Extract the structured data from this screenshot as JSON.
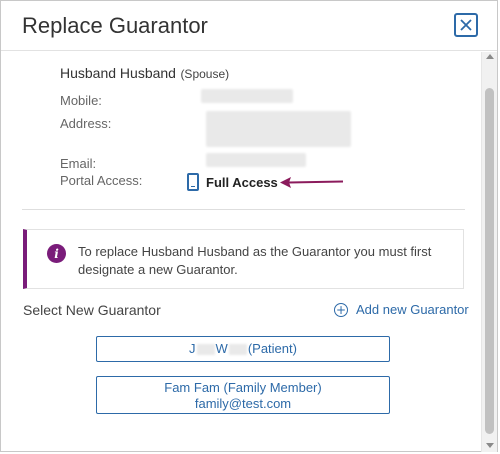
{
  "dialog": {
    "title": "Replace Guarantor"
  },
  "guarantor": {
    "name": "Husband Husband",
    "relationship": "(Spouse)",
    "labels": {
      "mobile": "Mobile:",
      "address": "Address:",
      "email": "Email:",
      "portal_access": "Portal Access:"
    },
    "portal_access_value": "Full Access"
  },
  "alert": {
    "message": "To replace Husband Husband as the Guarantor you must first designate a new Guarantor."
  },
  "select_section": {
    "label": "Select New Guarantor",
    "add_new_label": "Add new Guarantor"
  },
  "options": [
    {
      "prefix": "J",
      "middle": "W",
      "suffix": "(Patient)"
    },
    {
      "line1": "Fam Fam (Family Member)",
      "line2": "family@test.com"
    }
  ],
  "colors": {
    "accent": "#2d6aa8",
    "alert_purple": "#7a1c7a",
    "arrow": "#8b1b5c"
  },
  "icons": {
    "close": "close-icon",
    "phone": "mobile-phone-icon",
    "info": "info-icon",
    "add": "plus-circle-icon"
  }
}
